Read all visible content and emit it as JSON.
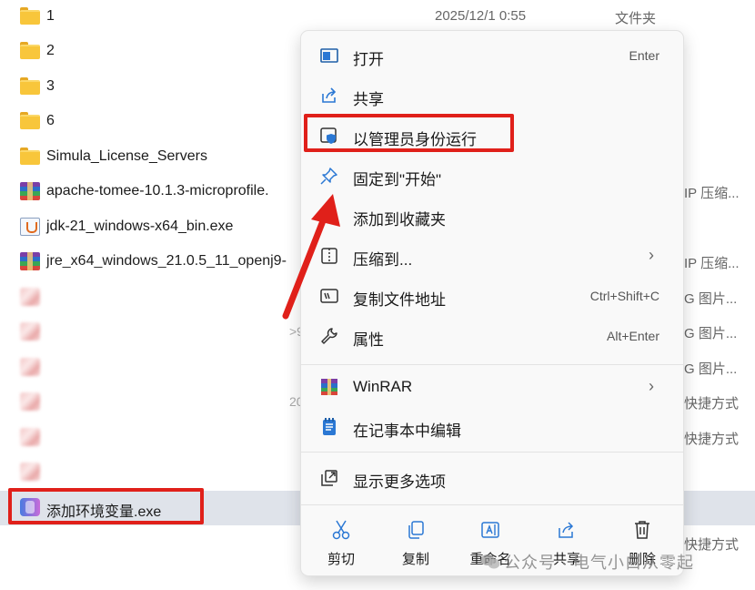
{
  "files": [
    {
      "name": "1",
      "icon": "folder-icon",
      "date": "2025/12/1 0:55",
      "type": "文件夹"
    },
    {
      "name": "2",
      "icon": "folder-icon",
      "date": "",
      "type": ""
    },
    {
      "name": "3",
      "icon": "folder-icon",
      "date": "",
      "type": ""
    },
    {
      "name": "6",
      "icon": "folder-icon",
      "date": "",
      "type": ""
    },
    {
      "name": "Simula_License_Servers",
      "icon": "folder-icon",
      "date": "",
      "type": ""
    },
    {
      "name": "apache-tomee-10.1.3-microprofile.",
      "icon": "winrar-archive-icon",
      "date": "",
      "type": "IP 压缩..."
    },
    {
      "name": "jdk-21_windows-x64_bin.exe",
      "icon": "java-installer-icon",
      "date": "",
      "type": ""
    },
    {
      "name": "jre_x64_windows_21.0.5_11_openj9-",
      "icon": "winrar-archive-icon",
      "date": "",
      "type": "IP 压缩..."
    },
    {
      "name": "",
      "icon": "image-file-icon",
      "date": "",
      "type": "G 图片..."
    },
    {
      "name": "",
      "icon": "image-file-icon",
      "date": ">9",
      "type": "G 图片..."
    },
    {
      "name": "",
      "icon": "image-file-icon",
      "date": "",
      "type": "G 图片..."
    },
    {
      "name": "",
      "icon": "shortcut-icon",
      "date": "20",
      "type": "快捷方式"
    },
    {
      "name": "",
      "icon": "shortcut-icon",
      "date": "",
      "type": "快捷方式"
    },
    {
      "name": "",
      "icon": "shortcut-icon",
      "date": "",
      "type": ""
    },
    {
      "name": "添加环境变量.exe",
      "icon": "exe-app-icon",
      "date": "",
      "type": ""
    },
    {
      "name": "",
      "icon": "",
      "date": "",
      "type": "快捷方式"
    }
  ],
  "context_menu": {
    "items": [
      {
        "label": "打开",
        "shortcut": "Enter",
        "icon": "open-window-icon"
      },
      {
        "label": "共享",
        "shortcut": "",
        "icon": "share-icon"
      },
      {
        "label": "以管理员身份运行",
        "shortcut": "",
        "icon": "run-as-admin-shield-icon"
      },
      {
        "label": "固定到\"开始\"",
        "shortcut": "",
        "icon": "pin-icon"
      },
      {
        "label": "添加到收藏夹",
        "shortcut": "",
        "icon": "star-icon"
      },
      {
        "label": "压缩到...",
        "shortcut": "",
        "icon": "compress-icon",
        "submenu": true
      },
      {
        "label": "复制文件地址",
        "shortcut": "Ctrl+Shift+C",
        "icon": "copy-path-icon"
      },
      {
        "label": "属性",
        "shortcut": "Alt+Enter",
        "icon": "wrench-icon"
      },
      {
        "label": "WinRAR",
        "shortcut": "",
        "icon": "winrar-icon",
        "submenu": true
      },
      {
        "label": "在记事本中编辑",
        "shortcut": "",
        "icon": "notepad-icon"
      },
      {
        "label": "显示更多选项",
        "shortcut": "",
        "icon": "more-options-icon"
      }
    ],
    "chevron": "›",
    "actions": [
      {
        "label": "剪切",
        "icon": "scissors-icon"
      },
      {
        "label": "复制",
        "icon": "copy-icon"
      },
      {
        "label": "重命名",
        "icon": "rename-icon"
      },
      {
        "label": "共享",
        "icon": "share-icon"
      },
      {
        "label": "删除",
        "icon": "trash-icon"
      }
    ]
  },
  "watermark": {
    "text": "公众号 · 电气小白从零起"
  },
  "colors": {
    "highlight": "#e0201a",
    "selected_row": "#dfe3ea",
    "accent": "#0067c0"
  }
}
